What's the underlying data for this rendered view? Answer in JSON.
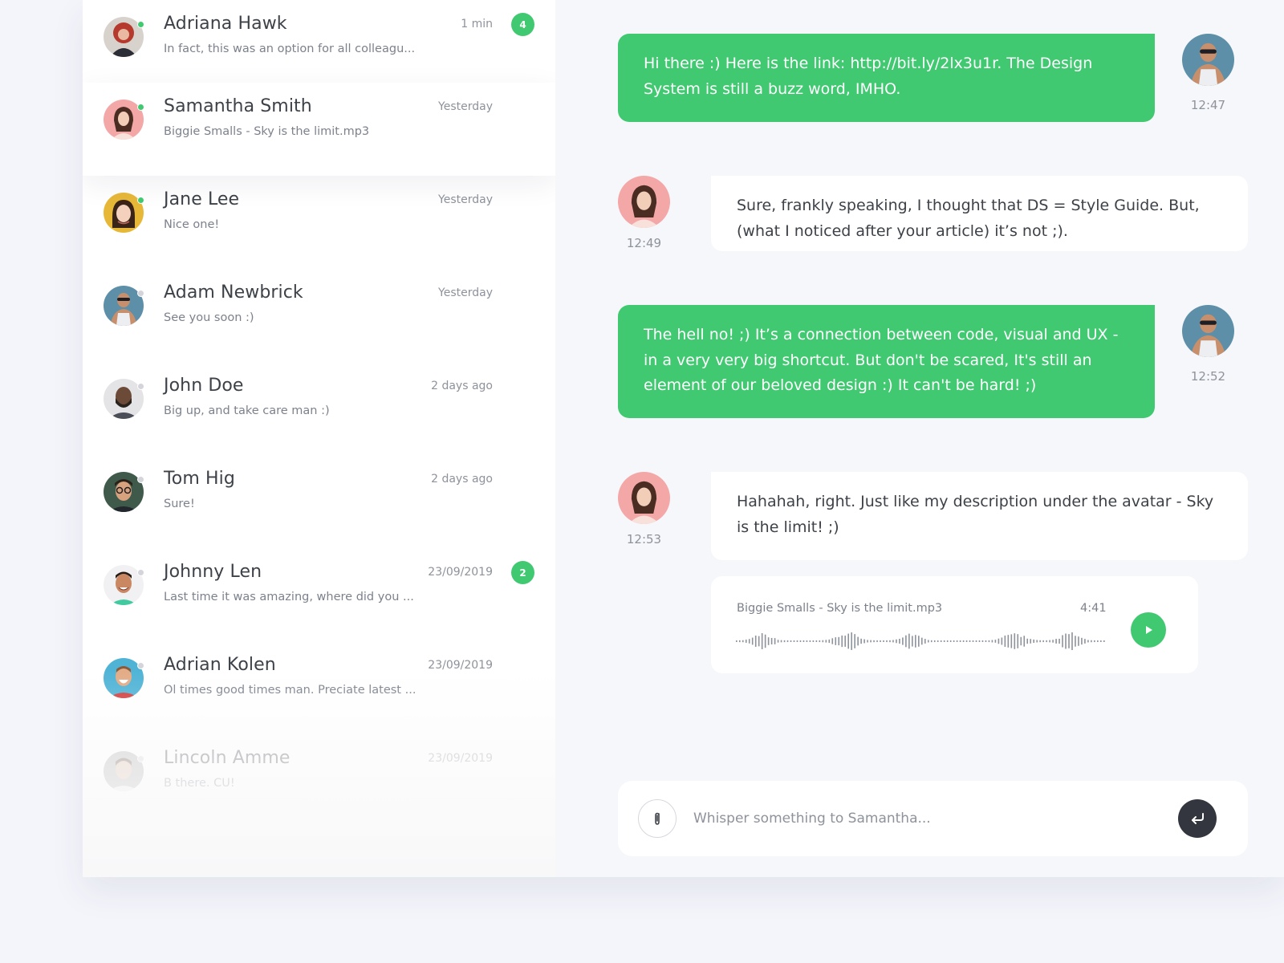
{
  "colors": {
    "accent": "#41c971",
    "text": "#3d4148",
    "muted": "#8e929b",
    "send_button": "#33363e"
  },
  "contacts": [
    {
      "name": "Adriana Hawk",
      "preview": "In fact, this was an option for all colleagu...",
      "time": "1 min",
      "badge": "4",
      "status": "online",
      "avatar_icon": "red-hair-woman-avatar"
    },
    {
      "name": "Samantha Smith",
      "preview": "Biggie Smalls - Sky is the limit.mp3",
      "time": "Yesterday",
      "badge": "",
      "status": "online",
      "avatar_icon": "woman-pink-background-avatar"
    },
    {
      "name": "Jane Lee",
      "preview": "Nice one!",
      "time": "Yesterday",
      "badge": "",
      "status": "online",
      "avatar_icon": "asian-woman-yellow-background-avatar"
    },
    {
      "name": "Adam Newbrick",
      "preview": "See you soon :)",
      "time": "Yesterday",
      "badge": "",
      "status": "offline",
      "avatar_icon": "man-sunglasses-avatar"
    },
    {
      "name": "John Doe",
      "preview": "Big up, and take care man :)",
      "time": "2 days ago",
      "badge": "",
      "status": "offline",
      "avatar_icon": "bearded-man-avatar"
    },
    {
      "name": "Tom Hig",
      "preview": "Sure!",
      "time": "2 days ago",
      "badge": "",
      "status": "offline",
      "avatar_icon": "man-glasses-avatar"
    },
    {
      "name": "Johnny Len",
      "preview": "Last time it was amazing, where did you ...",
      "time": "23/09/2019",
      "badge": "2",
      "status": "offline",
      "avatar_icon": "smiling-man-avatar"
    },
    {
      "name": "Adrian Kolen",
      "preview": "Ol times good times man. Preciate latest ...",
      "time": "23/09/2019",
      "badge": "",
      "status": "offline",
      "avatar_icon": "laughing-man-blue-background-avatar"
    },
    {
      "name": "Lincoln Amme",
      "preview": "B there. CU!",
      "time": "23/09/2019",
      "badge": "",
      "status": "offline",
      "avatar_icon": "man-grey-background-avatar"
    }
  ],
  "messages": [
    {
      "direction": "out",
      "text": "Hi there :) Here is the link: http://bit.ly/2lx3u1r. The Design System is still a buzz word, IMHO.",
      "time": "12:47"
    },
    {
      "direction": "in",
      "text": "Sure, frankly speaking, I thought that DS = Style Guide. But, (what I noticed after your article) it’s not ;).",
      "time": "12:49"
    },
    {
      "direction": "out",
      "text": "The hell no! ;) It’s a connection between code, visual and UX - in a very very big shortcut. But don't be scared, It's still an element of our beloved design :) It can't be hard! ;)",
      "time": "12:52"
    },
    {
      "direction": "in",
      "text": "Hahahah, right. Just like my description under the avatar - Sky is the limit! ;)",
      "time": "12:53"
    }
  ],
  "audio": {
    "title": "Biggie Smalls - Sky is the limit.mp3",
    "duration": "4:41",
    "play_icon": "play-icon"
  },
  "composer": {
    "placeholder": "Whisper something to Samantha...",
    "attach_icon": "paperclip-icon",
    "send_icon": "enter-arrow-icon"
  }
}
